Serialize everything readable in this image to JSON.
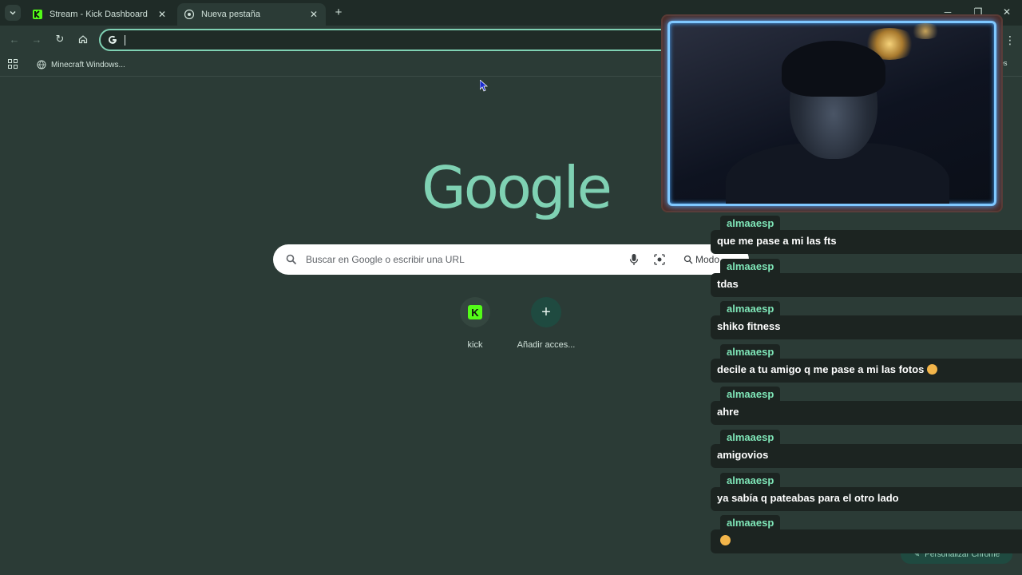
{
  "tabs": [
    {
      "title": "Stream - Kick Dashboard",
      "favicon": "kick-icon",
      "active": false
    },
    {
      "title": "Nueva pestaña",
      "favicon": "chrome-icon",
      "active": true
    }
  ],
  "bookmarks": [
    {
      "label": "Minecraft Windows..."
    }
  ],
  "bookmarks_right_label": "ores",
  "ntp": {
    "logo_text": "Google",
    "search_placeholder": "Buscar en Google o escribir una URL",
    "ai_mode_label": "Modo",
    "shortcuts": [
      {
        "label": "kick",
        "icon": "kick-icon",
        "tile_text": "K"
      },
      {
        "label": "Añadir acces...",
        "icon": "plus-icon",
        "tile_text": "+"
      }
    ],
    "customize_label": "Personalizar Chrome"
  },
  "chat": [
    {
      "user": "almaaesp",
      "text": "que me pase a mi las fts"
    },
    {
      "user": "almaaesp",
      "text": "tdas"
    },
    {
      "user": "almaaesp",
      "text": "shiko fitness"
    },
    {
      "user": "almaaesp",
      "text": "decile a tu amigo q me pase a mi las fotos",
      "emoji": true
    },
    {
      "user": "almaaesp",
      "text": "ahre"
    },
    {
      "user": "almaaesp",
      "text": "amigovios"
    },
    {
      "user": "almaaesp",
      "text": "ya sabía q pateabas para el otro lado"
    },
    {
      "user": "almaaesp",
      "text": "",
      "emoji": true
    }
  ],
  "colors": {
    "accent": "#7fd1b3",
    "background": "#2b3b36",
    "chat_user": "#7fe6b8",
    "kick_green": "#53fc18"
  }
}
